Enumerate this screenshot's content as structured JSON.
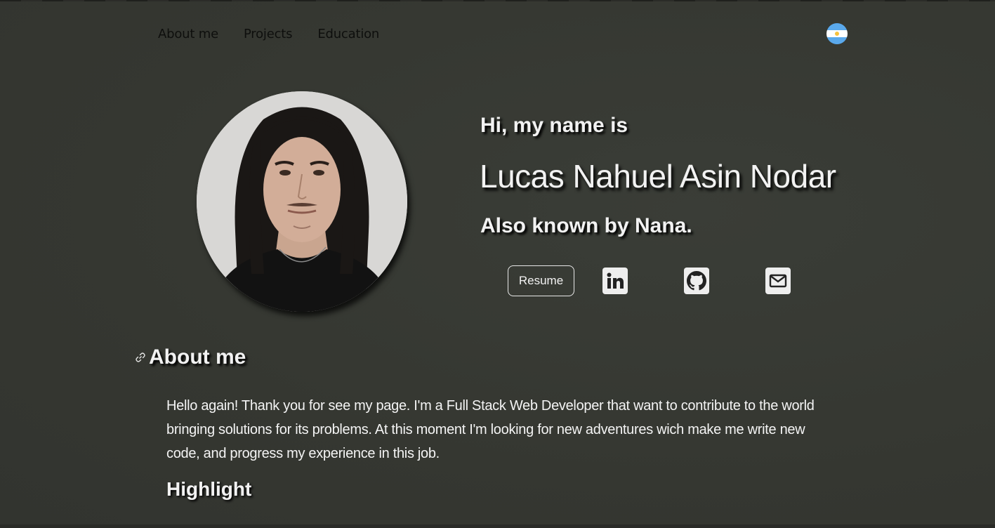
{
  "nav": {
    "items": [
      {
        "label": "About me"
      },
      {
        "label": "Projects"
      },
      {
        "label": "Education"
      }
    ],
    "language_icon": "argentina-flag-icon"
  },
  "hero": {
    "greeting": "Hi, my name is",
    "name": "Lucas Nahuel Asin Nodar",
    "aka": "Also known by Nana.",
    "resume_label": "Resume",
    "social": [
      {
        "icon": "linkedin-icon"
      },
      {
        "icon": "github-icon"
      },
      {
        "icon": "mail-icon"
      }
    ]
  },
  "about": {
    "link_icon": "link-icon",
    "title": "About me",
    "text": "Hello again! Thank you for see my page. I'm a Full Stack Web Developer that want to contribute to the world bringing solutions for its problems. At this moment I'm looking for new adventures wich make me write new code, and progress my experience in this job.",
    "highlight_title": "Highlight"
  },
  "colors": {
    "background": "#363833",
    "text": "#f2f2f2",
    "nav_text": "#0e0f0d",
    "icon_bg": "#eeeeee"
  }
}
